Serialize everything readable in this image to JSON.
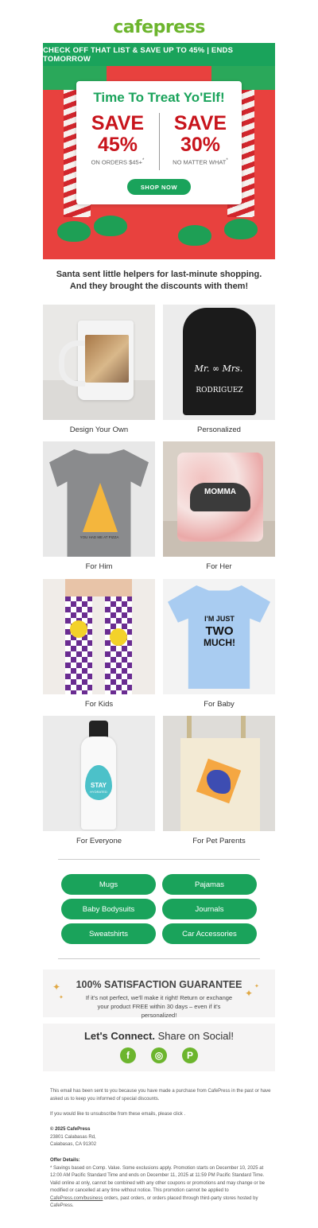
{
  "brand": {
    "logo": "cafepress"
  },
  "banner": {
    "text": "CHECK OFF THAT LIST & SAVE UP TO 45%  |  ENDS TOMORROW"
  },
  "hero": {
    "title": "Time To Treat Yo'Elf!",
    "offer_left": {
      "line1": "SAVE",
      "line2": "45%",
      "note": "ON ORDERS $45+",
      "mark": "*"
    },
    "offer_right": {
      "line1": "SAVE",
      "line2": "30%",
      "note": "NO MATTER WHAT",
      "mark": "*"
    },
    "button": "SHOP NOW"
  },
  "tagline": {
    "line1": "Santa sent little helpers for last-minute shopping.",
    "line2": "And they brought the discounts with them!"
  },
  "products": [
    {
      "label": "Design Your Own"
    },
    {
      "label": "Personalized",
      "art_text_1": "Mr.",
      "art_text_2": "Mrs.",
      "art_text_3": "RODRIGUEZ"
    },
    {
      "label": "For Him",
      "art_text_1": "YOU HAD ME AT PIZZA"
    },
    {
      "label": "For Her",
      "art_text_1": "MOMMA"
    },
    {
      "label": "For Kids"
    },
    {
      "label": "For Baby",
      "art_text_1": "I'M JUST",
      "art_text_2": "TWO",
      "art_text_3": "MUCH!"
    },
    {
      "label": "For Everyone",
      "art_text_1": "STAY",
      "art_text_2": "HYDRATED"
    },
    {
      "label": "For Pet Parents"
    }
  ],
  "categories": [
    "Mugs",
    "Pajamas",
    "Baby Bodysuits",
    "Journals",
    "Sweatshirts",
    "Car Accessories"
  ],
  "guarantee": {
    "title": "100% SATISFACTION GUARANTEE",
    "line1": "If it's not perfect, we'll make it right! Return or exchange",
    "line2": "your product FREE within 30 days – even if it's personalized!"
  },
  "social": {
    "title_bold": "Let's Connect.",
    "title_rest": " Share on Social!",
    "icons": [
      "facebook-icon",
      "instagram-icon",
      "pinterest-icon"
    ],
    "glyphs": [
      "f",
      "◎",
      "P"
    ]
  },
  "footer": {
    "notice": "This email has been sent to you because you have made a purchase from CafePress in the past or have asked us to keep you informed of special discounts.",
    "unsubscribe": "If you would like to unsubscribe from these emails, please click .",
    "copyright": "© 2025 CafePress",
    "address1": "23801 Calabasas Rd,",
    "address2": "Calabasas, CA 91302",
    "offer_title": "Offer Details:",
    "offer_text_1": "* Savings based on Comp. Value. Some exclusions apply. Promotion starts on December 10, 2025 at 12:00 AM Pacific Standard Time and ends on December 11, 2025 at 11:59 PM Pacific Standard Time. Valid online at  only, cannot be combined with any other coupons or promotions and may change or be modified or cancelled at any time without notice. This promotion cannot be applied to ",
    "offer_link": "CafePress.com/business",
    "offer_text_2": " orders, past orders, or orders placed through third-party stores hosted by CafePress."
  },
  "colors": {
    "brand_green": "#1aa35b",
    "logo_green": "#6cb52d",
    "save_red": "#c8141c",
    "hero_bg": "#e8413e"
  }
}
